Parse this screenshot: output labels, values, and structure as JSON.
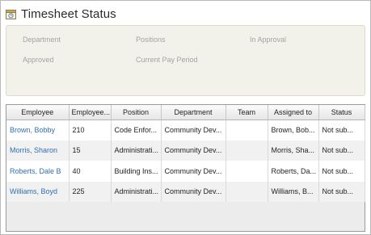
{
  "header": {
    "title": "Timesheet Status",
    "icon": "timesheet-icon"
  },
  "filters": {
    "department_label": "Department",
    "positions_label": "Positions",
    "in_approval_label": "In Approval",
    "approved_label": "Approved",
    "current_pay_period_label": "Current Pay Period"
  },
  "table": {
    "columns": [
      "Employee",
      "Employee...",
      "Position",
      "Department",
      "Team",
      "Assigned to",
      "Status"
    ],
    "rows": [
      [
        "Brown, Bobby",
        "210",
        "Code Enfor...",
        "Community Dev...",
        "",
        "Brown, Bob...",
        "Not sub..."
      ],
      [
        "Morris, Sharon",
        "15",
        "Administrati...",
        "Community Dev...",
        "",
        "Morris, Sha...",
        "Not sub..."
      ],
      [
        "Roberts, Dale B",
        "40",
        "Building Ins...",
        "Community Dev...",
        "",
        "Roberts, Da...",
        "Not sub..."
      ],
      [
        "Williams, Boyd",
        "225",
        "Administrati...",
        "Community Dev...",
        "",
        "Williams, B...",
        "Not sub..."
      ]
    ]
  },
  "colors": {
    "link": "#2f6fb3",
    "panel": "#f3f2ea"
  }
}
